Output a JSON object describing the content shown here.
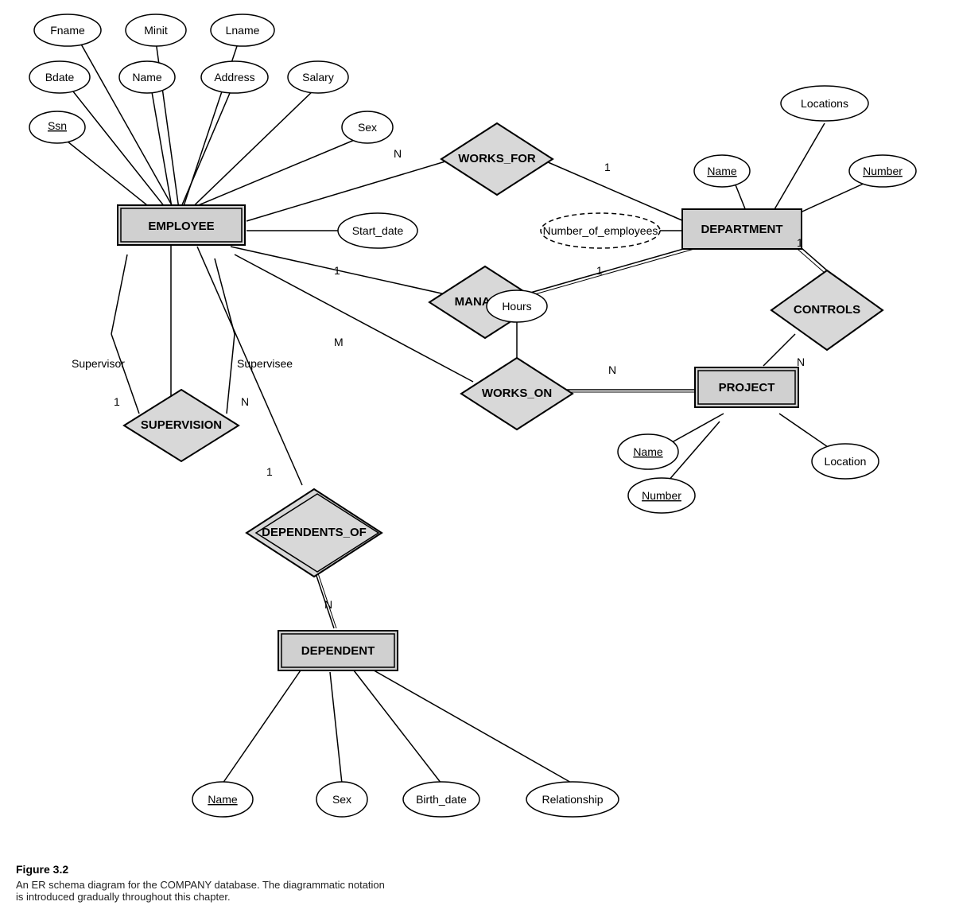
{
  "caption": {
    "title": "Figure 3.2",
    "line1": "An ER schema diagram for the COMPANY database. The diagrammatic notation",
    "line2": "is introduced gradually throughout this chapter."
  },
  "entities": {
    "employee": "EMPLOYEE",
    "department": "DEPARTMENT",
    "project": "PROJECT",
    "dependent": "DEPENDENT"
  },
  "relationships": {
    "works_for": "WORKS_FOR",
    "manages": "MANAGES",
    "works_on": "WORKS_ON",
    "supervision": "SUPERVISION",
    "dependents_of": "DEPENDENTS_OF",
    "controls": "CONTROLS"
  },
  "attributes": {
    "fname": "Fname",
    "minit": "Minit",
    "lname": "Lname",
    "bdate": "Bdate",
    "name_emp": "Name",
    "address": "Address",
    "salary": "Salary",
    "ssn": "Ssn",
    "sex_emp": "Sex",
    "start_date": "Start_date",
    "number_of_employees": "Number_of_employees",
    "locations": "Locations",
    "name_dept": "Name",
    "number_dept": "Number",
    "hours": "Hours",
    "name_proj": "Name",
    "number_proj": "Number",
    "location_proj": "Location",
    "name_dep": "Name",
    "sex_dep": "Sex",
    "birth_date": "Birth_date",
    "relationship": "Relationship"
  },
  "labels": {
    "n1": "N",
    "one1": "1",
    "one2": "1",
    "one3": "1",
    "m1": "M",
    "n2": "N",
    "one4": "1",
    "n3": "N",
    "n4": "N",
    "supervisor": "Supervisor",
    "supervisee": "Supervisee"
  }
}
